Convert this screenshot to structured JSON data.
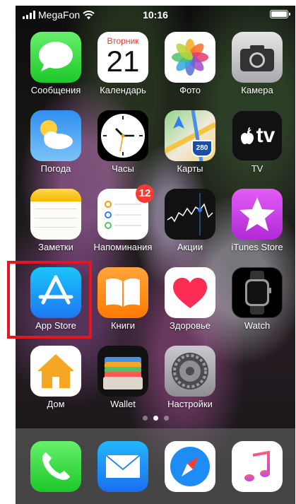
{
  "status": {
    "carrier": "MegaFon",
    "time": "10:16"
  },
  "apps": [
    {
      "label": "Сообщения"
    },
    {
      "label": "Календарь",
      "weekday": "Вторник",
      "day": "21"
    },
    {
      "label": "Фото"
    },
    {
      "label": "Камера"
    },
    {
      "label": "Погода"
    },
    {
      "label": "Часы"
    },
    {
      "label": "Карты",
      "road_sign": "280"
    },
    {
      "label": "TV",
      "icon_text": "tv"
    },
    {
      "label": "Заметки"
    },
    {
      "label": "Напоминания",
      "badge": "12"
    },
    {
      "label": "Акции"
    },
    {
      "label": "iTunes Store"
    },
    {
      "label": "App Store"
    },
    {
      "label": "Книги"
    },
    {
      "label": "Здоровье"
    },
    {
      "label": "Watch"
    },
    {
      "label": "Дом"
    },
    {
      "label": "Wallet"
    },
    {
      "label": "Настройки"
    }
  ],
  "page_dots": {
    "count": 3,
    "active": 1
  },
  "dock": [
    "phone-icon",
    "mail-icon",
    "safari-icon",
    "music-icon"
  ],
  "colors": {
    "highlight": "#e5161f",
    "badge": "#ff3b30"
  }
}
